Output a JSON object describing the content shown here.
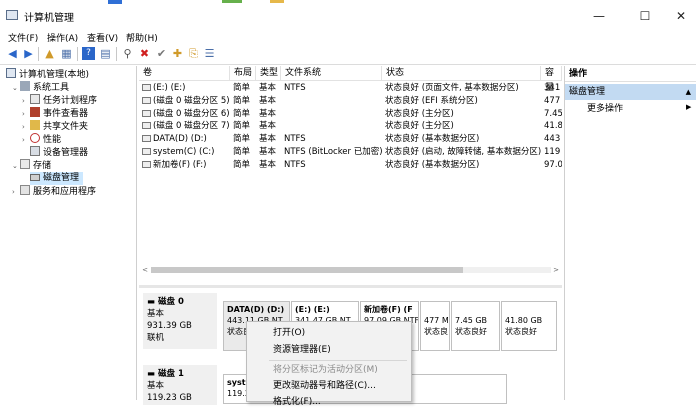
{
  "window": {
    "title": "计算机管理",
    "minimize": "—",
    "maximize": "☐",
    "close": "✕"
  },
  "menu": [
    "文件(F)",
    "操作(A)",
    "查看(V)",
    "帮助(H)"
  ],
  "toolbar": {
    "back": "◀",
    "forward": "▶",
    "up": "▲",
    "props": "▦",
    "help": "?",
    "view": "▤",
    "connect": "⚲",
    "delete": "✖",
    "check": "✔",
    "new": "✚",
    "export": "⎘",
    "list": "☰"
  },
  "tree": [
    {
      "label": "计算机管理(本地)",
      "indent": 0,
      "expander": ""
    },
    {
      "label": "系统工具",
      "indent": 1,
      "expander": "⌄"
    },
    {
      "label": "任务计划程序",
      "indent": 2,
      "expander": "›"
    },
    {
      "label": "事件查看器",
      "indent": 2,
      "expander": "›"
    },
    {
      "label": "共享文件夹",
      "indent": 2,
      "expander": "›"
    },
    {
      "label": "性能",
      "indent": 2,
      "expander": "›"
    },
    {
      "label": "设备管理器",
      "indent": 2,
      "expander": ""
    },
    {
      "label": "存储",
      "indent": 1,
      "expander": "⌄"
    },
    {
      "label": "磁盘管理",
      "indent": 2,
      "expander": ""
    },
    {
      "label": "服务和应用程序",
      "indent": 1,
      "expander": "›"
    }
  ],
  "columns": [
    "卷",
    "布局",
    "类型",
    "文件系统",
    "状态",
    "容量"
  ],
  "volumes": [
    [
      "(E:) (E:)",
      "简单",
      "基本",
      "NTFS",
      "状态良好 (页面文件, 基本数据分区)",
      "341"
    ],
    [
      "(磁盘 0 磁盘分区 5)",
      "简单",
      "基本",
      "",
      "状态良好 (EFI 系统分区)",
      "477"
    ],
    [
      "(磁盘 0 磁盘分区 6)",
      "简单",
      "基本",
      "",
      "状态良好 (主分区)",
      "7.45"
    ],
    [
      "(磁盘 0 磁盘分区 7)",
      "简单",
      "基本",
      "",
      "状态良好 (主分区)",
      "41.8"
    ],
    [
      "DATA(D) (D:)",
      "简单",
      "基本",
      "NTFS",
      "状态良好 (基本数据分区)",
      "443"
    ],
    [
      "system(C) (C:)",
      "简单",
      "基本",
      "NTFS (BitLocker 已加密)",
      "状态良好 (启动, 故障转储, 基本数据分区)",
      "119"
    ],
    [
      "新加卷(F) (F:)",
      "简单",
      "基本",
      "NTFS",
      "状态良好 (基本数据分区)",
      "97.0"
    ]
  ],
  "scroll": {
    "left": "<",
    "right": ">"
  },
  "disks": [
    {
      "name": "磁盘 0",
      "type": "基本",
      "size": "931.39 GB",
      "status": "联机"
    },
    {
      "name": "磁盘 1",
      "type": "基本",
      "size": "119.23 GB",
      "status": ""
    }
  ],
  "disk0_parts": [
    {
      "name": "DATA(D)  (D:)",
      "size": "443.11 GB NT",
      "status": "状态良"
    },
    {
      "name": "(E:)  (E:)",
      "size": "341.47 GB NT",
      "status": ""
    },
    {
      "name": "新加卷(F)  (F",
      "size": "97.09 GB NTF",
      "status": ""
    },
    {
      "name": "",
      "size": "477 M",
      "status": "状态良"
    },
    {
      "name": "",
      "size": "7.45 GB",
      "status": "状态良好"
    },
    {
      "name": "",
      "size": "41.80 GB",
      "status": "状态良好"
    }
  ],
  "disk1_part": {
    "name": "syste",
    "size": "119.2"
  },
  "actions": {
    "header": "操作",
    "section": "磁盘管理",
    "more": "更多操作",
    "collapse": "▲",
    "more_arrow": "▶"
  },
  "context_menu": [
    {
      "label": "打开(O)",
      "enabled": true
    },
    {
      "label": "资源管理器(E)",
      "enabled": true
    },
    {
      "label": "将分区标记为活动分区(M)",
      "enabled": false
    },
    {
      "label": "更改驱动器号和路径(C)...",
      "enabled": true
    },
    {
      "label": "格式化(F)...",
      "enabled": true
    }
  ],
  "colors": {
    "partition_bar": "#1e3f96",
    "selection": "#cce8ff",
    "action_section": "#c2daf2"
  }
}
